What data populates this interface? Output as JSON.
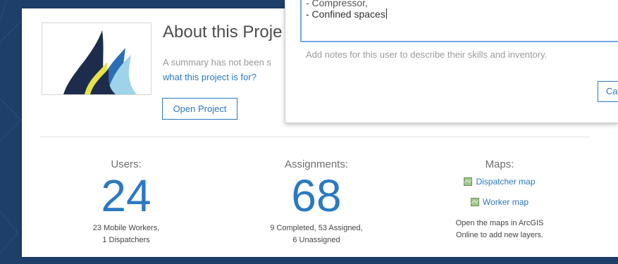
{
  "about": {
    "title": "About this Proje",
    "summary_line1": "A summary has not been s",
    "summary_link": "what this project is for?",
    "open_button": "Open Project"
  },
  "stats": {
    "users": {
      "label": "Users:",
      "count": "24",
      "detail_line1": "23 Mobile Workers,",
      "detail_line2": "1 Dispatchers"
    },
    "assignments": {
      "label": "Assignments:",
      "count": "68",
      "detail_line1": "9 Completed, 53 Assigned,",
      "detail_line2": "6 Unassigned"
    },
    "maps": {
      "label": "Maps:",
      "items": [
        "Dispatcher map",
        "Worker map"
      ],
      "note_line1": "Open the maps in ArcGIS",
      "note_line2": "Online to add new layers."
    }
  },
  "dialog": {
    "notes_line1": "- Compressor,",
    "notes_line2": "- Confined spaces",
    "hint": "Add notes for this user to describe their skills and inventory.",
    "cancel_button": "Ca"
  },
  "colors": {
    "accent": "#2b79c2",
    "background": "#1d3f6a",
    "input_focus": "#72a7dc"
  },
  "icons": [
    "project-logo-icon",
    "map-thumbnail-icon"
  ]
}
